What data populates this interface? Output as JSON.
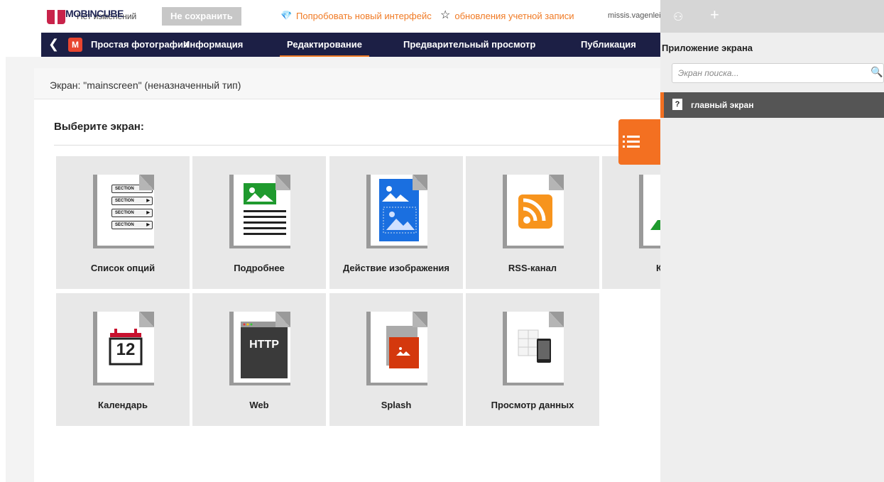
{
  "topbar": {
    "brand": "MOBINCUBE",
    "no_changes": "Нет изменений",
    "not_save": "Не сохранить",
    "try_new": "Попробовать новый интерфейс",
    "updates": "обновления учетной записи",
    "user": "missis.vagenleitner"
  },
  "nav": {
    "back_icon": "chevron-left-icon",
    "app_icon_letter": "M",
    "app_name": "Простая фотография",
    "tabs": [
      "Информация",
      "Редактирование",
      "Предварительный просмотр",
      "Публикация"
    ],
    "active_tab": "Редактирование",
    "accent": "#f07a24",
    "bar_color": "#1c1f45"
  },
  "panel": {
    "title": "Экран: \"mainscreen\" (неназначенный тип)",
    "choose": "Выберите экран:"
  },
  "tiles": [
    {
      "label": "Список опций",
      "icon": "section-list-icon",
      "sections": [
        "SECTION",
        "SECTION",
        "SECTION",
        "SECTION"
      ]
    },
    {
      "label": "Подробнее",
      "icon": "detail-icon"
    },
    {
      "label": "Действие изображения",
      "icon": "image-action-icon"
    },
    {
      "label": "RSS-канал",
      "icon": "rss-icon"
    },
    {
      "label": "К",
      "icon": "map-icon"
    },
    {
      "label": "Календарь",
      "icon": "calendar-icon",
      "day": "12"
    },
    {
      "label": "Web",
      "icon": "web-icon",
      "text": "HTTP"
    },
    {
      "label": "Splash",
      "icon": "splash-icon"
    },
    {
      "label": "Просмотр данных",
      "icon": "data-view-icon"
    }
  ],
  "sidebar": {
    "title": "Приложение экрана",
    "search_placeholder": "Экран поиска...",
    "items": [
      {
        "label": "главный экран",
        "badge": "?"
      }
    ]
  }
}
